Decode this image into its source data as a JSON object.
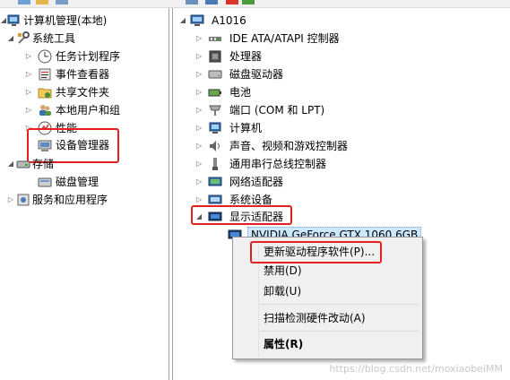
{
  "left_tree": {
    "root": "计算机管理(本地)",
    "system_tools": "系统工具",
    "task_scheduler": "任务计划程序",
    "event_viewer": "事件查看器",
    "shared_folders": "共享文件夹",
    "local_users": "本地用户和组",
    "performance": "性能",
    "device_manager": "设备管理器",
    "storage": "存储",
    "disk_management": "磁盘管理",
    "services_apps": "服务和应用程序"
  },
  "right_tree": {
    "computer_name": "A1016",
    "items": [
      "IDE ATA/ATAPI 控制器",
      "处理器",
      "磁盘驱动器",
      "电池",
      "端口 (COM 和 LPT)",
      "计算机",
      "声音、视频和游戏控制器",
      "通用串行总线控制器",
      "网络适配器",
      "系统设备",
      "显示适配器"
    ],
    "gpu": "NVIDIA GeForce GTX 1060 6GB"
  },
  "context_menu": {
    "update_driver": "更新驱动程序软件(P)...",
    "disable": "禁用(D)",
    "uninstall": "卸载(U)",
    "scan": "扫描检测硬件改动(A)",
    "properties": "属性(R)"
  },
  "watermark": "https://blog.csdn.net/moxiaobeiMM",
  "colors": {
    "highlight_box": "#e62020",
    "menu_bg": "#f0f0f0",
    "selection": "#cce8ff"
  }
}
